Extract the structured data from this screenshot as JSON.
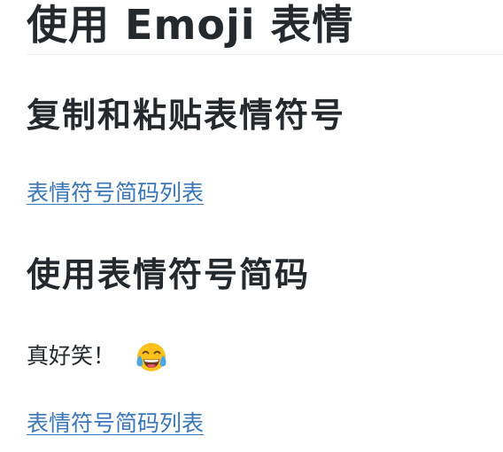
{
  "document": {
    "title": "使用 Emoji 表情",
    "sections": [
      {
        "heading": "复制和粘贴表情符号",
        "link_text": "表情符号简码列表"
      },
      {
        "heading": "使用表情符号简码",
        "example_text": "真好笑！",
        "example_emoji": "face-with-tears-of-joy-icon",
        "link_text": "表情符号简码列表"
      }
    ]
  },
  "colors": {
    "text": "#24292e",
    "link": "#3a76b8",
    "rule": "#eaecef",
    "emoji_face": "#fcc21b",
    "emoji_tears": "#4aa8e8"
  }
}
